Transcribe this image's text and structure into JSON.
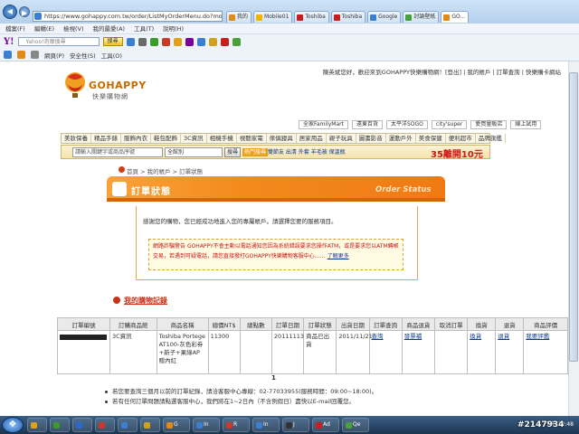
{
  "browser": {
    "address": "https://www.gohappy.com.tw/order/ListMyOrderMenu.do?module=list",
    "tabs": [
      {
        "label": "我的",
        "color": "#e08a1a",
        "active": false
      },
      {
        "label": "Mobile01",
        "color": "#f2b400",
        "active": false
      },
      {
        "label": "Toshiba",
        "color": "#c81e1e",
        "active": false
      },
      {
        "label": "Toshiba",
        "color": "#c81e1e",
        "active": false
      },
      {
        "label": "Google",
        "color": "#3a7fd0",
        "active": false
      },
      {
        "label": "討論壁紙",
        "color": "#4aa03a",
        "active": false
      },
      {
        "label": "GO...",
        "color": "#e08a1a",
        "active": true
      }
    ],
    "menu": [
      "檔案(F)",
      "編輯(E)",
      "檢視(V)",
      "我的最愛(A)",
      "工具(T)",
      "說明(H)"
    ],
    "yahoo_logo": "Y!",
    "yahoo_search_placeholder": "Yahoo!奇摩搜尋",
    "yahoo_search_button": "搜尋",
    "toolbar2": [
      "網頁(P)",
      "安全性(S)",
      "工具(O)"
    ]
  },
  "header": {
    "user_bar": "陳英斌您好，歡迎來到GOHAPPY快樂購物網！[登出] | 我的帳戶 | 訂單查詢 | 快樂購卡網站",
    "logo_text": "GOHAPPY",
    "logo_sub": "快樂購物網",
    "partners": [
      "全家FamilyMart",
      "遠東百貨",
      "太平洋SOGO",
      "city'super",
      "愛買量販店",
      "線上試用"
    ],
    "categories": [
      "美妝保養",
      "精品手錶",
      "服飾內衣",
      "鞋包配飾",
      "3C資訊",
      "相機手機",
      "視聽家電",
      "傢俱寢具",
      "居家用品",
      "親子玩具",
      "圖書影音",
      "運動戶外",
      "美食保健",
      "便利超市",
      "品牌旗艦"
    ],
    "search_placeholder": "請輸入關鍵字或商品序號",
    "search_select": "全館別",
    "search_button": "搜尋",
    "hot_keywords_label": "熱門搜尋",
    "hot_keywords": "雙節友 出清 外套 羊毛被 保溫瓶",
    "promo": "35離開10元"
  },
  "breadcrumb": "首頁 > 我的帳戶 > 訂單狀態",
  "status": {
    "title": "訂單狀態",
    "title_en": "Order Status",
    "message": "感謝您的購物，您已經成功地進入您的專屬帳戶。請選擇您要的服務項目。",
    "warning_label": "網路詐騙警告",
    "warning_text": "GOHAPPY不會主動以電話通知您因為系統錯誤要求您操作ATM，或是要求您以ATM轉帳交易，若遇到可疑電話，請您直接撥打GOHAPPY快樂購物客服中心……",
    "warning_link": "了解更多"
  },
  "records": {
    "title": "我的購物記錄",
    "columns": [
      "訂單編號",
      "訂購商品館",
      "商品名稱",
      "總價NT$",
      "總點數",
      "訂單日期",
      "訂單狀態",
      "出貨日期",
      "訂單查詢",
      "商品退貨",
      "取消訂單",
      "換貨",
      "退貨",
      "商品評價"
    ],
    "rows": [
      {
        "category": "3C資訊",
        "product": "Toshiba Portege AT100-灰色彩券+新子+果綠AP 贈內紅",
        "total": "11300",
        "points": "",
        "order_date": "20111113",
        "status": "商品已出貨",
        "ship_date": "2011/11/21",
        "query": "查詢",
        "return_goods": "發票補",
        "cancel": "",
        "exchange": "換貨",
        "refund": "退貨",
        "review": "我要評鑑"
      }
    ]
  },
  "page_number": "1",
  "notes": [
    "若您要查詢三個月以前的訂單紀錄，請洽客服中心專線：02-77033955(服務時間：09:00~18:00)。",
    "若有任何訂單問題請點選客服中心，我們將在1~2日內（不含例假日）盡快以E-mail回覆您。"
  ],
  "taskbar": {
    "items": [
      {
        "label": "",
        "color": "#e0a11a"
      },
      {
        "label": "",
        "color": "#3a9a2a"
      },
      {
        "label": "",
        "color": "#2a6ad0"
      },
      {
        "label": "",
        "color": "#c83a2a"
      },
      {
        "label": "",
        "color": "#3a7fd0"
      },
      {
        "label": "",
        "color": "#d0a020"
      },
      {
        "label": "G",
        "color": "#e08a1a"
      },
      {
        "label": "In",
        "color": "#3a7fd0"
      },
      {
        "label": "R",
        "color": "#c83a2a"
      },
      {
        "label": "In",
        "color": "#3a7fd0"
      },
      {
        "label": "J",
        "color": "#333333"
      },
      {
        "label": "Ad",
        "color": "#c81e1e"
      },
      {
        "label": "Qe",
        "color": "#4aa03a"
      }
    ],
    "tray_time": "下午 12:48",
    "watermark": "#2147934"
  }
}
